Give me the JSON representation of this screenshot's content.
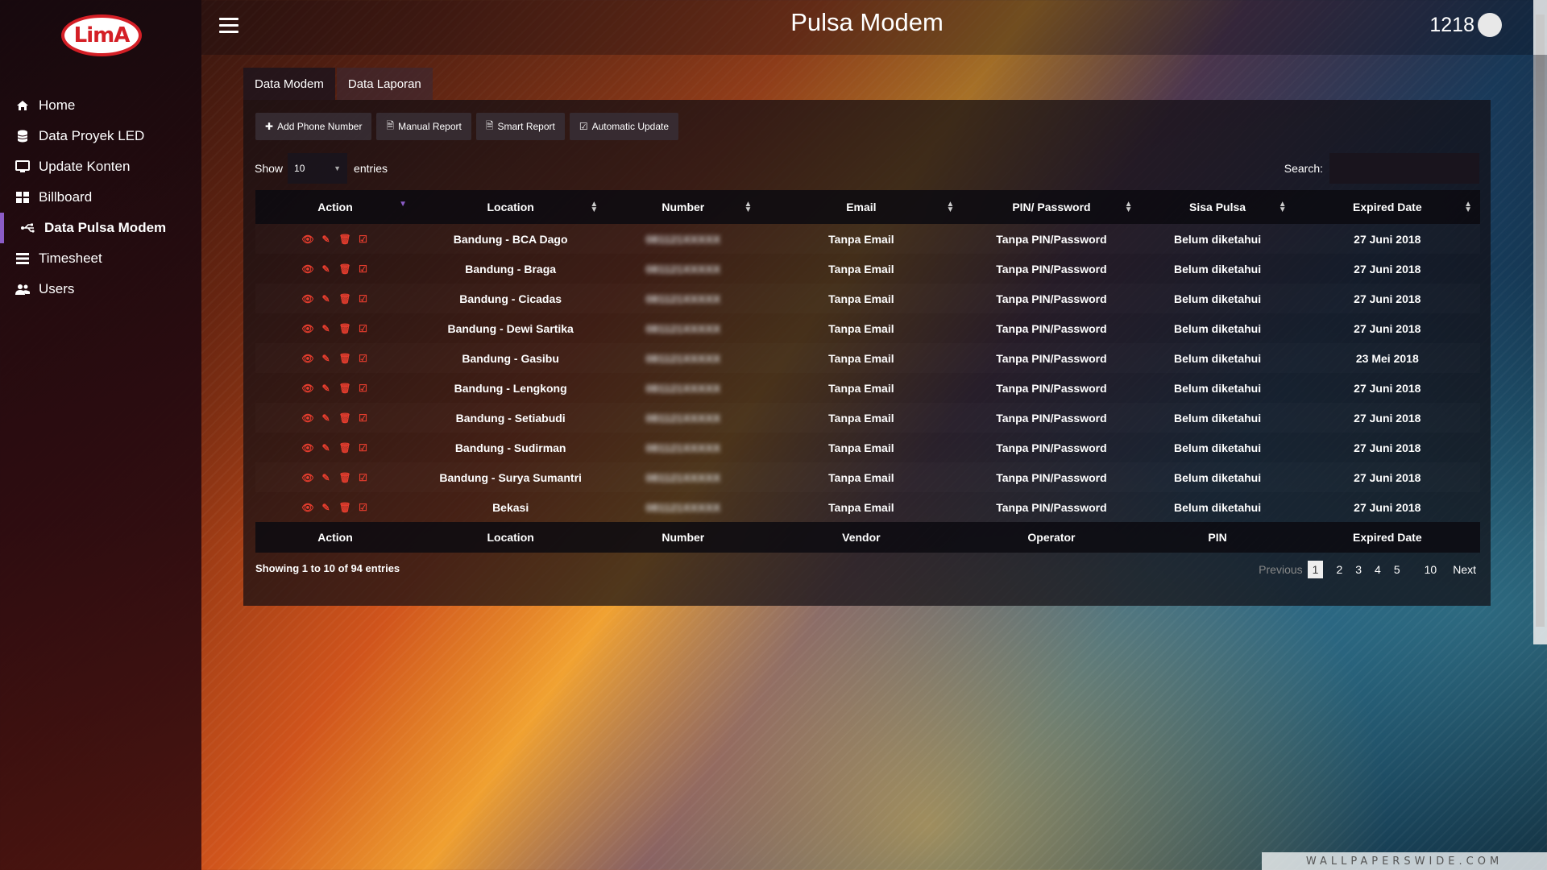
{
  "app": {
    "logo_text": "LimA",
    "title": "Pulsa Modem",
    "user_id": "1218"
  },
  "sidebar": {
    "items": [
      {
        "label": "Home",
        "icon": "home-icon"
      },
      {
        "label": "Data Proyek LED",
        "icon": "database-icon"
      },
      {
        "label": "Update Konten",
        "icon": "monitor-icon"
      },
      {
        "label": "Billboard",
        "icon": "grid-icon"
      },
      {
        "label": "Data Pulsa Modem",
        "icon": "usb-icon",
        "active": true
      },
      {
        "label": "Timesheet",
        "icon": "list-icon"
      },
      {
        "label": "Users",
        "icon": "users-icon"
      }
    ]
  },
  "tabs": [
    {
      "label": "Data Modem",
      "active": true
    },
    {
      "label": "Data Laporan"
    }
  ],
  "toolbar": {
    "add_label": "Add Phone Number",
    "manual_label": "Manual Report",
    "smart_label": "Smart Report",
    "auto_label": "Automatic Update"
  },
  "table_controls": {
    "show_label": "Show",
    "entries_value": "10",
    "entries_label": "entries",
    "search_label": "Search:"
  },
  "table": {
    "headers": [
      "Action",
      "Location",
      "Number",
      "Email",
      "PIN/ Password",
      "Sisa Pulsa",
      "Expired Date"
    ],
    "footers": [
      "Action",
      "Location",
      "Number",
      "Vendor",
      "Operator",
      "PIN",
      "Expired Date"
    ],
    "rows": [
      {
        "location": "Bandung - BCA Dago",
        "number": "081121XXXXX",
        "email": "Tanpa Email",
        "pin": "Tanpa PIN/Password",
        "sisa": "Belum diketahui",
        "expired": "27 Juni 2018"
      },
      {
        "location": "Bandung - Braga",
        "number": "081121XXXXX",
        "email": "Tanpa Email",
        "pin": "Tanpa PIN/Password",
        "sisa": "Belum diketahui",
        "expired": "27 Juni 2018"
      },
      {
        "location": "Bandung - Cicadas",
        "number": "081121XXXXX",
        "email": "Tanpa Email",
        "pin": "Tanpa PIN/Password",
        "sisa": "Belum diketahui",
        "expired": "27 Juni 2018"
      },
      {
        "location": "Bandung - Dewi Sartika",
        "number": "081121XXXXX",
        "email": "Tanpa Email",
        "pin": "Tanpa PIN/Password",
        "sisa": "Belum diketahui",
        "expired": "27 Juni 2018"
      },
      {
        "location": "Bandung - Gasibu",
        "number": "081121XXXXX",
        "email": "Tanpa Email",
        "pin": "Tanpa PIN/Password",
        "sisa": "Belum diketahui",
        "expired": "23 Mei 2018"
      },
      {
        "location": "Bandung - Lengkong",
        "number": "081121XXXXX",
        "email": "Tanpa Email",
        "pin": "Tanpa PIN/Password",
        "sisa": "Belum diketahui",
        "expired": "27 Juni 2018"
      },
      {
        "location": "Bandung - Setiabudi",
        "number": "081121XXXXX",
        "email": "Tanpa Email",
        "pin": "Tanpa PIN/Password",
        "sisa": "Belum diketahui",
        "expired": "27 Juni 2018"
      },
      {
        "location": "Bandung - Sudirman",
        "number": "081121XXXXX",
        "email": "Tanpa Email",
        "pin": "Tanpa PIN/Password",
        "sisa": "Belum diketahui",
        "expired": "27 Juni 2018"
      },
      {
        "location": "Bandung - Surya Sumantri",
        "number": "081121XXXXX",
        "email": "Tanpa Email",
        "pin": "Tanpa PIN/Password",
        "sisa": "Belum diketahui",
        "expired": "27 Juni 2018"
      },
      {
        "location": "Bekasi",
        "number": "081121XXXXX",
        "email": "Tanpa Email",
        "pin": "Tanpa PIN/Password",
        "sisa": "Belum diketahui",
        "expired": "27 Juni 2018"
      }
    ]
  },
  "footer": {
    "info": "Showing 1 to 10 of 94 entries",
    "pager": {
      "prev": "Previous",
      "pages": [
        "1",
        "2",
        "3",
        "4",
        "5",
        "10"
      ],
      "current": "1",
      "next": "Next"
    }
  },
  "watermark": "WALLPAPERSWIDE.COM",
  "colors": {
    "accent": "#8b5cc6",
    "action_icons": "#e63d2e",
    "logo_red": "#d41f26"
  }
}
